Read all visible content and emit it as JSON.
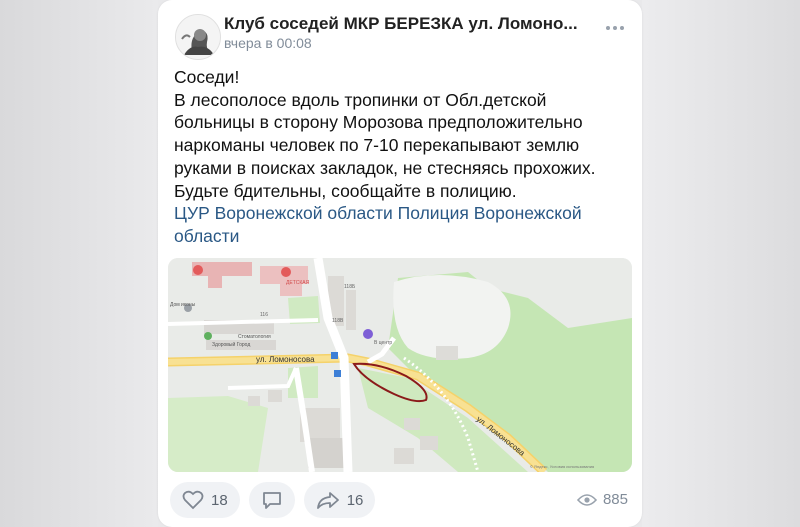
{
  "post": {
    "group_title": "Клуб соседей МКР БЕРЕЗКА ул. Ломоно...",
    "time": "вчера в 00:08",
    "text": {
      "greeting": "Соседи!",
      "line1": "В лесополосе вдоль тропинки от Обл.детской",
      "line2": "больницы в сторону Морозова предположительно",
      "line3": "наркоманы человек по 7-10 перекапывают землю",
      "line4": "руками в поисках закладок, не стесняясь прохожих.",
      "line5": "Будьте бдительны, сообщайте в полицию."
    },
    "links": {
      "line1": "ЦУР Воронежской области Полиция Воронежской",
      "line2": "области"
    }
  },
  "map": {
    "street_main": "ул. Ломоносова",
    "street_diag": "ул. Ломоносова",
    "label_dom": "Дом иконы",
    "label_children": "ДЕТСКАЯ",
    "label_health": "Здоровый Город",
    "label_health2": "Стоматология",
    "label_118": "118Б",
    "label_118v": "118В",
    "label_116": "116",
    "label_center": "В центр",
    "label_credit": "© Яндекс, Условия использования"
  },
  "actions": {
    "likes": "18",
    "reposts": "16",
    "views": "885"
  },
  "colors": {
    "link": "#2a5885",
    "icon": "#99a2ad",
    "annotation": "#8b1a1a"
  }
}
